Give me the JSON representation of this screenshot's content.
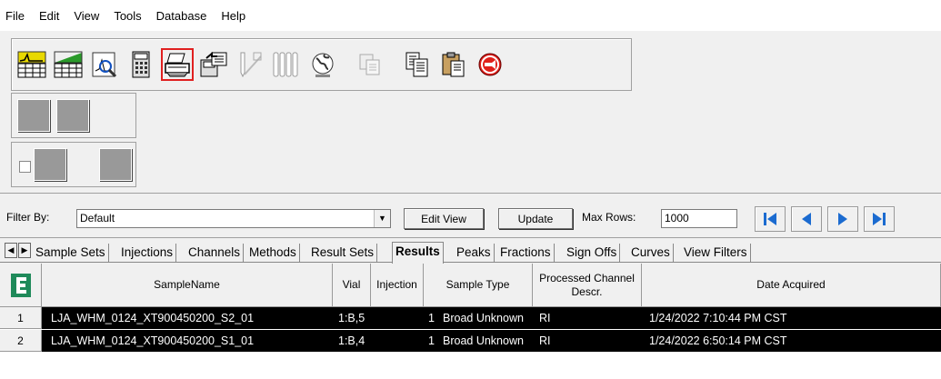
{
  "menu": [
    "File",
    "Edit",
    "View",
    "Tools",
    "Database",
    "Help"
  ],
  "toolbar": {
    "icons": [
      "sample-sets-icon",
      "results-icon",
      "review-icon",
      "calculator-icon",
      "print-icon",
      "export-icon",
      "syringe-icon",
      "vials-icon",
      "globe-icon",
      "copy-disabled-icon",
      "copy-icon",
      "paste-icon",
      "stop-icon"
    ],
    "selected": "print-icon"
  },
  "filter": {
    "label": "Filter By:",
    "value": "Default",
    "edit_view_label": "Edit View",
    "update_label": "Update",
    "max_rows_label": "Max Rows:",
    "max_rows_value": "1000"
  },
  "tabs": [
    "Sample Sets",
    "Injections",
    "Channels",
    "Methods",
    "Result Sets",
    "Results",
    "Peaks",
    "Fractions",
    "Sign Offs",
    "Curves",
    "View Filters"
  ],
  "active_tab": "Results",
  "table": {
    "columns": [
      "SampleName",
      "Vial",
      "Injection",
      "Sample Type",
      "Processed Channel Descr.",
      "Date Acquired"
    ],
    "rows": [
      {
        "num": "1",
        "sample": "LJA_WHM_0124_XT900450200_S2_01",
        "vial": "1:B,5",
        "injection": "1",
        "type": "Broad Unknown",
        "channel": "RI",
        "date": "1/24/2022 7:10:44 PM CST"
      },
      {
        "num": "2",
        "sample": "LJA_WHM_0124_XT900450200_S1_01",
        "vial": "1:B,4",
        "injection": "1",
        "type": "Broad Unknown",
        "channel": "RI",
        "date": "1/24/2022 6:50:14 PM CST"
      }
    ]
  },
  "colors": {
    "selection": "#000000",
    "nav_blue": "#1b6bd0",
    "stop_red": "#e0201a",
    "highlight_border": "#e02020"
  }
}
